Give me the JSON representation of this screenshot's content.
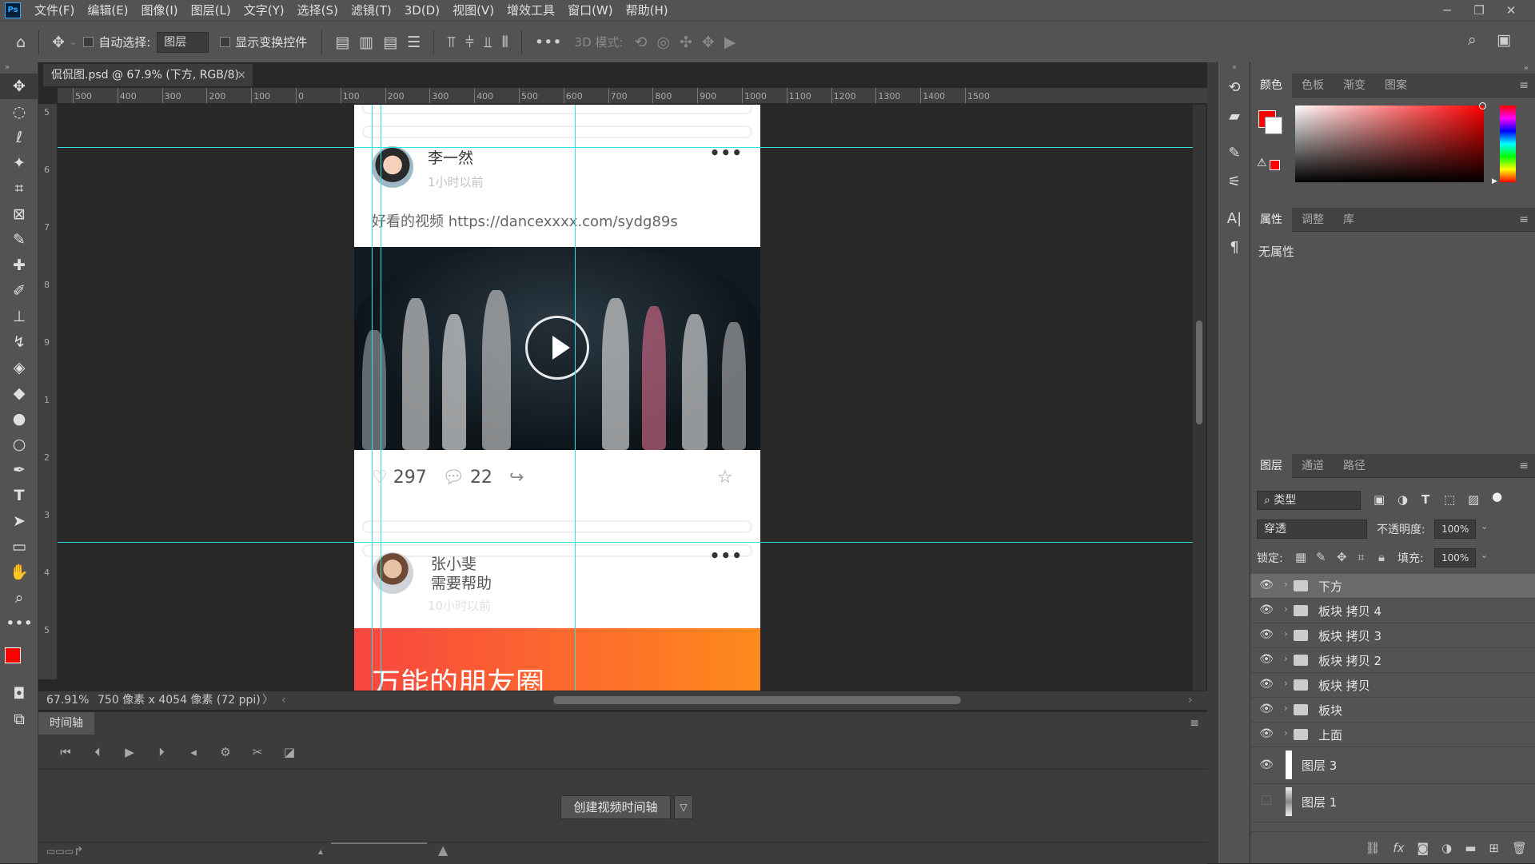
{
  "menubar": {
    "logo": "Ps",
    "items": [
      "文件(F)",
      "编辑(E)",
      "图像(I)",
      "图层(L)",
      "文字(Y)",
      "选择(S)",
      "滤镜(T)",
      "3D(D)",
      "视图(V)",
      "增效工具",
      "窗口(W)",
      "帮助(H)"
    ],
    "window_controls": [
      "─",
      "❐",
      "✕"
    ]
  },
  "optionsbar": {
    "auto_select_label": "自动选择:",
    "auto_select_value": "图层",
    "show_transform_label": "显示变换控件",
    "mode3d_label": "3D 模式:"
  },
  "document": {
    "tab_title": "侃侃图.psd @ 67.9% (下方, RGB/8)",
    "close": "×",
    "zoom": "67.91%",
    "info": "750 像素 x 4054 像素 (72 ppi)",
    "hruler_labels": [
      "500",
      "400",
      "300",
      "200",
      "100",
      "0",
      "100",
      "200",
      "300",
      "400",
      "500",
      "600",
      "700",
      "800",
      "900",
      "1000",
      "1100",
      "1200",
      "1300",
      "1400",
      "1500"
    ],
    "vruler_labels": [
      "5",
      "6",
      "7",
      "8",
      "9",
      "1",
      "2",
      "3",
      "4",
      "5"
    ]
  },
  "artboard": {
    "post1": {
      "name": "李一然",
      "time": "1小时以前",
      "text": "好看的视频 https://dancexxxx.com/sydg89s",
      "likes": "297",
      "comments": "22"
    },
    "post2": {
      "name": "张小斐",
      "line2": "需要帮助",
      "time": "10小时以前",
      "banner": "万能的朋友圈"
    }
  },
  "timeline": {
    "tab": "时间轴",
    "create_button": "创建视频时间轴"
  },
  "color_panel": {
    "tabs": [
      "颜色",
      "色板",
      "渐变",
      "图案"
    ],
    "foreground": "#ff0000",
    "background": "#ffffff"
  },
  "properties_panel": {
    "tabs": [
      "属性",
      "调整",
      "库"
    ],
    "empty_text": "无属性"
  },
  "layers_panel": {
    "tabs": [
      "图层",
      "通道",
      "路径"
    ],
    "filter_label": "类型",
    "blend_mode": "穿透",
    "opacity_label": "不透明度:",
    "opacity_value": "100%",
    "lock_label": "锁定:",
    "fill_label": "填充:",
    "fill_value": "100%",
    "layers": [
      {
        "name": "下方",
        "type": "group",
        "visible": true,
        "selected": true
      },
      {
        "name": "板块 拷贝 4",
        "type": "group",
        "visible": true
      },
      {
        "name": "板块 拷贝 3",
        "type": "group",
        "visible": true
      },
      {
        "name": "板块 拷贝 2",
        "type": "group",
        "visible": true
      },
      {
        "name": "板块 拷贝",
        "type": "group",
        "visible": true
      },
      {
        "name": "板块",
        "type": "group",
        "visible": true
      },
      {
        "name": "上面",
        "type": "group",
        "visible": true
      },
      {
        "name": "图层 3",
        "type": "layer",
        "visible": true
      },
      {
        "name": "图层 1",
        "type": "layer",
        "visible": false
      }
    ]
  },
  "colors": {
    "accent_guide": "#31e0e0",
    "banner_start": "#f84640",
    "banner_end": "#ff8a1c",
    "foreground_swatch": "#ff0000"
  }
}
